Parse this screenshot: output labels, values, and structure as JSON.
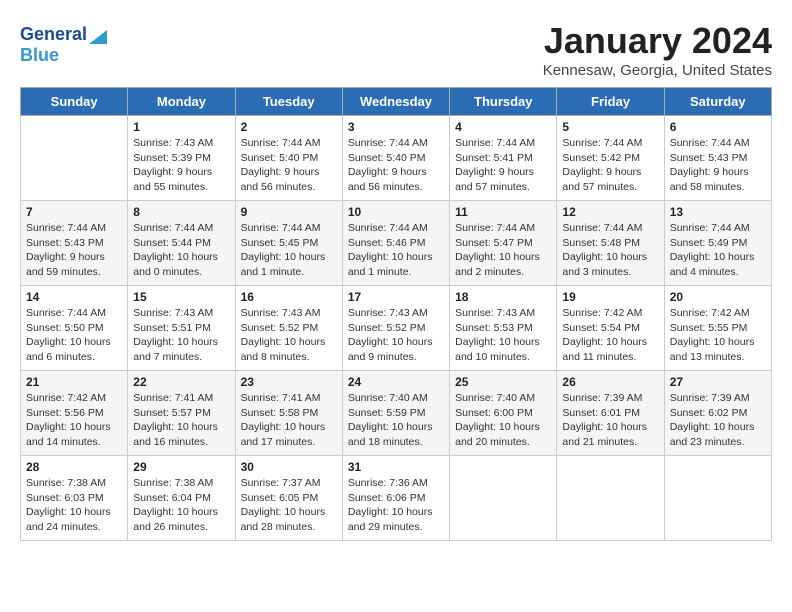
{
  "logo": {
    "general": "General",
    "blue": "Blue"
  },
  "header": {
    "title": "January 2024",
    "subtitle": "Kennesaw, Georgia, United States"
  },
  "weekdays": [
    "Sunday",
    "Monday",
    "Tuesday",
    "Wednesday",
    "Thursday",
    "Friday",
    "Saturday"
  ],
  "weeks": [
    [
      {
        "day": "",
        "sunrise": "",
        "sunset": "",
        "daylight": ""
      },
      {
        "day": "1",
        "sunrise": "Sunrise: 7:43 AM",
        "sunset": "Sunset: 5:39 PM",
        "daylight": "Daylight: 9 hours and 55 minutes."
      },
      {
        "day": "2",
        "sunrise": "Sunrise: 7:44 AM",
        "sunset": "Sunset: 5:40 PM",
        "daylight": "Daylight: 9 hours and 56 minutes."
      },
      {
        "day": "3",
        "sunrise": "Sunrise: 7:44 AM",
        "sunset": "Sunset: 5:40 PM",
        "daylight": "Daylight: 9 hours and 56 minutes."
      },
      {
        "day": "4",
        "sunrise": "Sunrise: 7:44 AM",
        "sunset": "Sunset: 5:41 PM",
        "daylight": "Daylight: 9 hours and 57 minutes."
      },
      {
        "day": "5",
        "sunrise": "Sunrise: 7:44 AM",
        "sunset": "Sunset: 5:42 PM",
        "daylight": "Daylight: 9 hours and 57 minutes."
      },
      {
        "day": "6",
        "sunrise": "Sunrise: 7:44 AM",
        "sunset": "Sunset: 5:43 PM",
        "daylight": "Daylight: 9 hours and 58 minutes."
      }
    ],
    [
      {
        "day": "7",
        "sunrise": "Sunrise: 7:44 AM",
        "sunset": "Sunset: 5:43 PM",
        "daylight": "Daylight: 9 hours and 59 minutes."
      },
      {
        "day": "8",
        "sunrise": "Sunrise: 7:44 AM",
        "sunset": "Sunset: 5:44 PM",
        "daylight": "Daylight: 10 hours and 0 minutes."
      },
      {
        "day": "9",
        "sunrise": "Sunrise: 7:44 AM",
        "sunset": "Sunset: 5:45 PM",
        "daylight": "Daylight: 10 hours and 1 minute."
      },
      {
        "day": "10",
        "sunrise": "Sunrise: 7:44 AM",
        "sunset": "Sunset: 5:46 PM",
        "daylight": "Daylight: 10 hours and 1 minute."
      },
      {
        "day": "11",
        "sunrise": "Sunrise: 7:44 AM",
        "sunset": "Sunset: 5:47 PM",
        "daylight": "Daylight: 10 hours and 2 minutes."
      },
      {
        "day": "12",
        "sunrise": "Sunrise: 7:44 AM",
        "sunset": "Sunset: 5:48 PM",
        "daylight": "Daylight: 10 hours and 3 minutes."
      },
      {
        "day": "13",
        "sunrise": "Sunrise: 7:44 AM",
        "sunset": "Sunset: 5:49 PM",
        "daylight": "Daylight: 10 hours and 4 minutes."
      }
    ],
    [
      {
        "day": "14",
        "sunrise": "Sunrise: 7:44 AM",
        "sunset": "Sunset: 5:50 PM",
        "daylight": "Daylight: 10 hours and 6 minutes."
      },
      {
        "day": "15",
        "sunrise": "Sunrise: 7:43 AM",
        "sunset": "Sunset: 5:51 PM",
        "daylight": "Daylight: 10 hours and 7 minutes."
      },
      {
        "day": "16",
        "sunrise": "Sunrise: 7:43 AM",
        "sunset": "Sunset: 5:52 PM",
        "daylight": "Daylight: 10 hours and 8 minutes."
      },
      {
        "day": "17",
        "sunrise": "Sunrise: 7:43 AM",
        "sunset": "Sunset: 5:52 PM",
        "daylight": "Daylight: 10 hours and 9 minutes."
      },
      {
        "day": "18",
        "sunrise": "Sunrise: 7:43 AM",
        "sunset": "Sunset: 5:53 PM",
        "daylight": "Daylight: 10 hours and 10 minutes."
      },
      {
        "day": "19",
        "sunrise": "Sunrise: 7:42 AM",
        "sunset": "Sunset: 5:54 PM",
        "daylight": "Daylight: 10 hours and 11 minutes."
      },
      {
        "day": "20",
        "sunrise": "Sunrise: 7:42 AM",
        "sunset": "Sunset: 5:55 PM",
        "daylight": "Daylight: 10 hours and 13 minutes."
      }
    ],
    [
      {
        "day": "21",
        "sunrise": "Sunrise: 7:42 AM",
        "sunset": "Sunset: 5:56 PM",
        "daylight": "Daylight: 10 hours and 14 minutes."
      },
      {
        "day": "22",
        "sunrise": "Sunrise: 7:41 AM",
        "sunset": "Sunset: 5:57 PM",
        "daylight": "Daylight: 10 hours and 16 minutes."
      },
      {
        "day": "23",
        "sunrise": "Sunrise: 7:41 AM",
        "sunset": "Sunset: 5:58 PM",
        "daylight": "Daylight: 10 hours and 17 minutes."
      },
      {
        "day": "24",
        "sunrise": "Sunrise: 7:40 AM",
        "sunset": "Sunset: 5:59 PM",
        "daylight": "Daylight: 10 hours and 18 minutes."
      },
      {
        "day": "25",
        "sunrise": "Sunrise: 7:40 AM",
        "sunset": "Sunset: 6:00 PM",
        "daylight": "Daylight: 10 hours and 20 minutes."
      },
      {
        "day": "26",
        "sunrise": "Sunrise: 7:39 AM",
        "sunset": "Sunset: 6:01 PM",
        "daylight": "Daylight: 10 hours and 21 minutes."
      },
      {
        "day": "27",
        "sunrise": "Sunrise: 7:39 AM",
        "sunset": "Sunset: 6:02 PM",
        "daylight": "Daylight: 10 hours and 23 minutes."
      }
    ],
    [
      {
        "day": "28",
        "sunrise": "Sunrise: 7:38 AM",
        "sunset": "Sunset: 6:03 PM",
        "daylight": "Daylight: 10 hours and 24 minutes."
      },
      {
        "day": "29",
        "sunrise": "Sunrise: 7:38 AM",
        "sunset": "Sunset: 6:04 PM",
        "daylight": "Daylight: 10 hours and 26 minutes."
      },
      {
        "day": "30",
        "sunrise": "Sunrise: 7:37 AM",
        "sunset": "Sunset: 6:05 PM",
        "daylight": "Daylight: 10 hours and 28 minutes."
      },
      {
        "day": "31",
        "sunrise": "Sunrise: 7:36 AM",
        "sunset": "Sunset: 6:06 PM",
        "daylight": "Daylight: 10 hours and 29 minutes."
      },
      {
        "day": "",
        "sunrise": "",
        "sunset": "",
        "daylight": ""
      },
      {
        "day": "",
        "sunrise": "",
        "sunset": "",
        "daylight": ""
      },
      {
        "day": "",
        "sunrise": "",
        "sunset": "",
        "daylight": ""
      }
    ]
  ]
}
